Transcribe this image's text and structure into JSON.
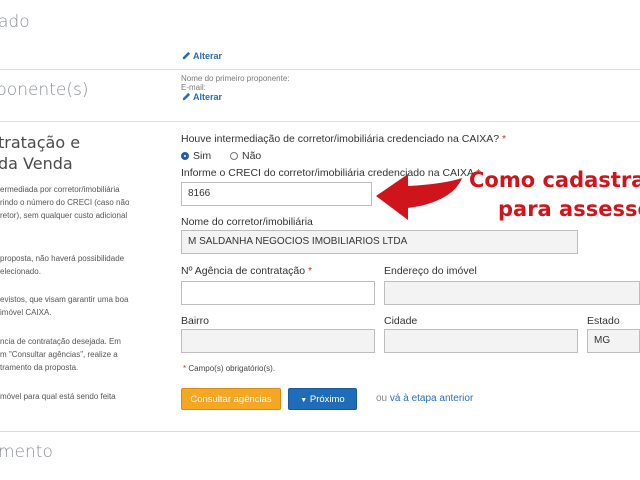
{
  "sections": {
    "top_title": "ado",
    "proponents_title": "ponente(s)",
    "bottom_title": "mento"
  },
  "links": {
    "alterar_1": "Alterar",
    "alterar_2": "Alterar",
    "previous_prefix": "ou",
    "previous_step": "vá à etapa anterior"
  },
  "proponent": {
    "name_label": "Nome do primeiro proponente:",
    "email_label": "E-mail:"
  },
  "sidebar": {
    "title_line1": "tratação e",
    "title_line2": "da Venda",
    "paragraphs": [
      [
        "ermediada por corretor/imobiliária",
        "rindo o número do CRECI (caso não",
        "retor), sem qualquer custo adicional"
      ],
      [
        "proposta, não haverá possibilidade",
        "elecionado."
      ],
      [
        "evistos, que visam garantir uma boa",
        "imóvel CAIXA."
      ],
      [
        "ncia de contratação desejada. Em",
        "m \"Consultar agências\", realize a",
        "tramento da proposta."
      ],
      [
        "móvel para qual está sendo feita"
      ]
    ]
  },
  "form": {
    "intermediation_question": "Houve intermediação de corretor/imobiliária credenciado na CAIXA?",
    "required_mark": "*",
    "radio_yes": "Sim",
    "radio_no": "Não",
    "creci_label": "Informe o CRECI do corretor/imobiliária credenciado na CAIXA",
    "creci_value": "8166",
    "broker_name_label": "Nome do corretor/imobiliária",
    "broker_name_value": "M SALDANHA NEGOCIOS IMOBILIARIOS LTDA",
    "agency_label": "Nº Agência de contratação",
    "agency_value": "",
    "address_label": "Endereço do imóvel",
    "address_value": "",
    "district_label": "Bairro",
    "district_value": "",
    "city_label": "Cidade",
    "city_value": "",
    "state_label": "Estado",
    "state_value": "MG",
    "required_note": "Campo(s) obrigatório(s)."
  },
  "buttons": {
    "consult_agencies": "Consultar agências",
    "next": "Próximo"
  },
  "annotation": {
    "line1": "Como cadastrar",
    "line2": "para assessor",
    "color": "#d0141c"
  }
}
